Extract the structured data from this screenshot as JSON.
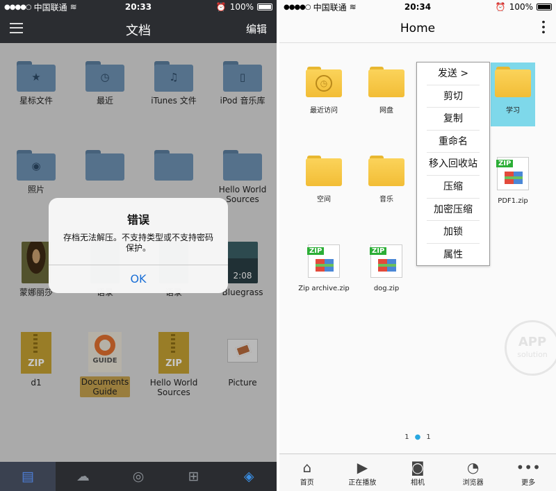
{
  "left": {
    "status": {
      "signal": "●●●●○",
      "carrier": "中国联通",
      "wifi": "≋",
      "time": "20:33",
      "battery": "100%"
    },
    "nav": {
      "title": "文档",
      "edit": "编辑"
    },
    "items": [
      {
        "label": "星标文件",
        "icon": "star-folder-icon",
        "glyph": "★"
      },
      {
        "label": "最近",
        "icon": "clock-folder-icon",
        "glyph": "◷"
      },
      {
        "label": "iTunes 文件",
        "icon": "music-folder-icon",
        "glyph": "♫"
      },
      {
        "label": "iPod 音乐库",
        "icon": "ipod-folder-icon",
        "glyph": "▯"
      },
      {
        "label": "照片",
        "icon": "camera-folder-icon",
        "glyph": "◉"
      },
      {
        "label": "",
        "icon": "folder-icon",
        "glyph": ""
      },
      {
        "label": "",
        "icon": "folder-icon",
        "glyph": ""
      },
      {
        "label": "Hello World Sources",
        "icon": "folder-icon",
        "glyph": ""
      },
      {
        "label": "蒙娜丽莎",
        "icon": "mona-lisa-thumbnail",
        "glyph": ""
      },
      {
        "label": "语录",
        "icon": "image-thumbnail",
        "glyph": ""
      },
      {
        "label": "语录",
        "icon": "image-thumbnail",
        "glyph": ""
      },
      {
        "label": "Bluegrass",
        "icon": "video-thumbnail",
        "glyph": "2:08"
      },
      {
        "label": "d1",
        "icon": "zip-icon",
        "glyph": "ZIP"
      },
      {
        "label": "Documents Guide",
        "icon": "guide-icon",
        "glyph": "GUIDE"
      },
      {
        "label": "Hello World Sources",
        "icon": "zip-icon",
        "glyph": "ZIP"
      },
      {
        "label": "Picture",
        "icon": "picture-icon",
        "glyph": ""
      }
    ],
    "alert": {
      "title": "错误",
      "message": "存档无法解压。不支持类型或不支持密码保护。",
      "ok": "OK"
    },
    "tabs": [
      {
        "icon": "document-icon",
        "glyph": "▤"
      },
      {
        "icon": "cloud-icon",
        "glyph": "☁"
      },
      {
        "icon": "wifi-icon",
        "glyph": "◎"
      },
      {
        "icon": "cart-icon",
        "glyph": "⊞"
      },
      {
        "icon": "compass-icon",
        "glyph": "◈"
      }
    ]
  },
  "right": {
    "status": {
      "signal": "●●●●○",
      "carrier": "中国联通",
      "wifi": "≋",
      "time": "20:34",
      "battery": "100%"
    },
    "nav": {
      "title": "Home"
    },
    "items": [
      {
        "label": "最近访问",
        "kind": "folder-clock"
      },
      {
        "label": "网盘",
        "kind": "folder"
      },
      {
        "label": "学习",
        "kind": "folder"
      },
      {
        "label": "空间",
        "kind": "folder"
      },
      {
        "label": "音乐",
        "kind": "folder"
      },
      {
        "label": "PDF1.zip",
        "kind": "zip"
      },
      {
        "label": "Zip archive.zip",
        "kind": "zip"
      },
      {
        "label": "dog.zip",
        "kind": "zip"
      }
    ],
    "zip_tag": "ZIP",
    "menu": [
      "发送 >",
      "剪切",
      "复制",
      "重命名",
      "移入回收站",
      "压缩",
      "加密压缩",
      "加锁",
      "属性"
    ],
    "pager": {
      "left": "1",
      "right": "1"
    },
    "watermark": {
      "line1": "APP",
      "line2": "solution"
    },
    "tabs": [
      {
        "label": "首页",
        "icon": "home-icon",
        "glyph": "⌂"
      },
      {
        "label": "正在播放",
        "icon": "play-icon",
        "glyph": "▶"
      },
      {
        "label": "相机",
        "icon": "camera-icon",
        "glyph": "◙"
      },
      {
        "label": "浏览器",
        "icon": "compass-icon",
        "glyph": "◔"
      },
      {
        "label": "更多",
        "icon": "more-icon",
        "glyph": "•••"
      }
    ]
  }
}
